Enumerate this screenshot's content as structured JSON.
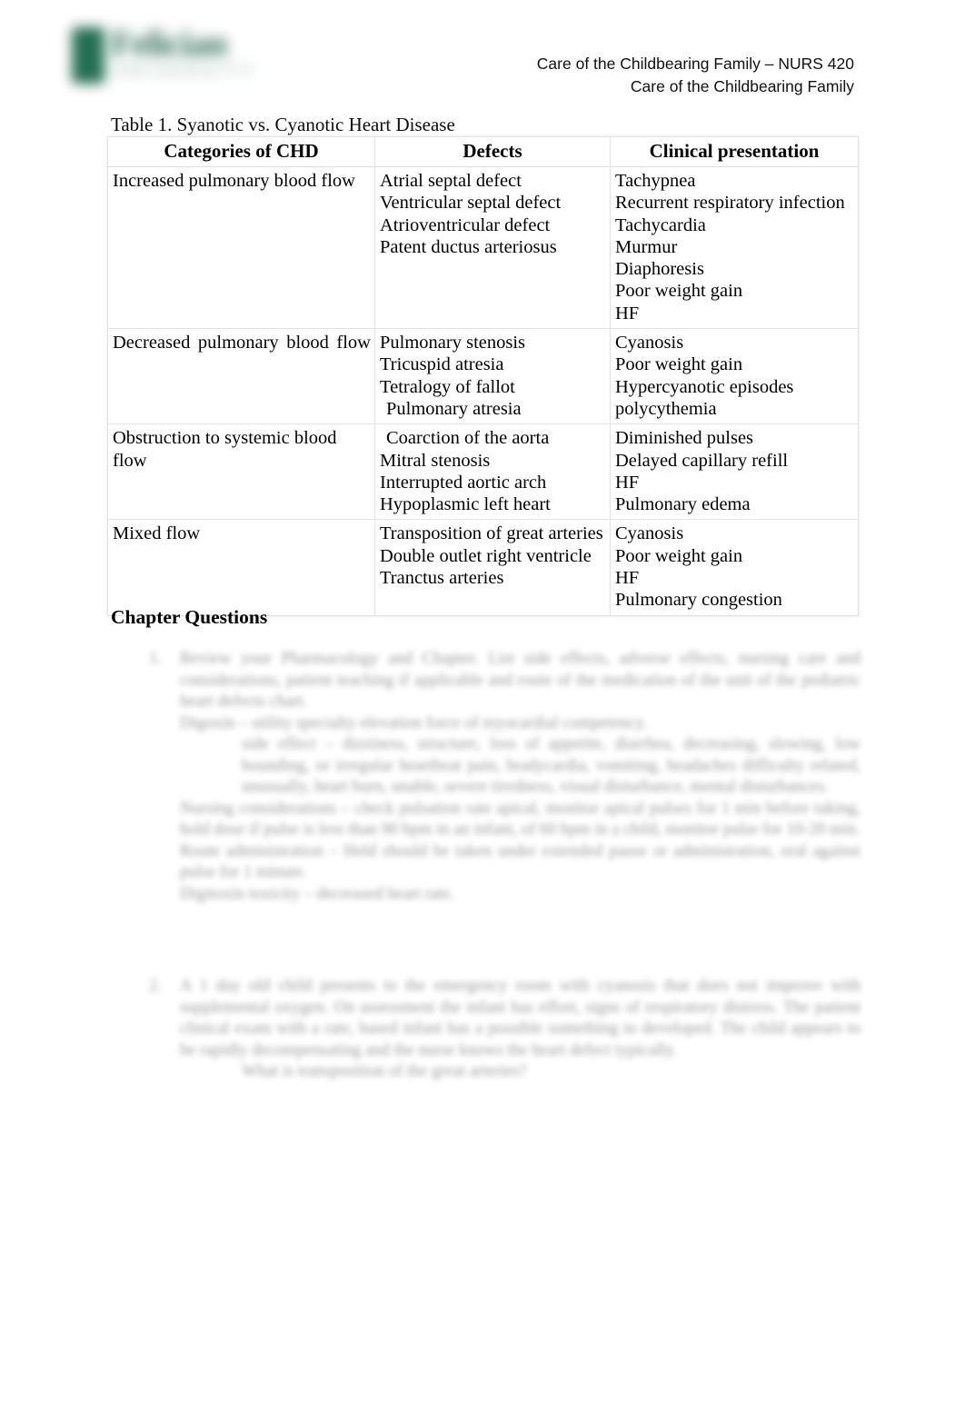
{
  "header": {
    "logo_word": "Felician",
    "logo_sub": "UNIVERSITY",
    "line1": "Care of the Childbearing Family – NURS 420",
    "line2": "Care of the Childbearing Family"
  },
  "table": {
    "caption": "Table 1. Syanotic vs. Cyanotic Heart Disease",
    "columns": [
      "Categories of CHD",
      "Defects",
      "Clinical presentation"
    ],
    "rows": [
      {
        "category": "Increased pulmonary blood flow",
        "defects": [
          "Atrial septal defect",
          "Ventricular septal defect",
          "Atrioventricular defect",
          "Patent ductus arteriosus"
        ],
        "clinical": [
          "Tachypnea",
          "Recurrent respiratory infection",
          "Tachycardia",
          "Murmur",
          "Diaphoresis",
          "Poor weight gain",
          "HF"
        ]
      },
      {
        "category": "Decreased pulmonary blood flow",
        "defects": [
          "Pulmonary stenosis",
          "Tricuspid atresia",
          "Tetralogy of fallot",
          "Pulmonary atresia"
        ],
        "clinical": [
          "Cyanosis",
          "Poor weight gain",
          "Hypercyanotic episodes",
          "polycythemia"
        ]
      },
      {
        "category": "Obstruction to systemic blood flow",
        "defects": [
          "Coarction of the aorta",
          "Mitral stenosis",
          "Interrupted aortic arch",
          "Hypoplasmic left heart"
        ],
        "clinical": [
          "Diminished pulses",
          "Delayed capillary refill",
          "HF",
          "Pulmonary edema"
        ]
      },
      {
        "category": "Mixed flow",
        "defects": [
          "Transposition of great arteries",
          "Double outlet right ventricle",
          "Tranctus arteries"
        ],
        "clinical": [
          "Cyanosis",
          "Poor weight gain",
          "HF",
          "Pulmonary congestion"
        ]
      }
    ]
  },
  "chapter_questions": {
    "heading": "Chapter Questions",
    "items": [
      {
        "number": "1.",
        "paragraphs": [
          "Review your Pharmacology and Chapter. List side effects, adverse effects, nursing care and considerations, patient teaching if applicable and route of the medication of the unit of the pediatric heart defects chart.",
          "Digoxin – utility specialty elevation force of myocardial competency.",
          "side effect – dizziness, structure, loss of appetite, diarrhea, decreasing, slowing, low bounding, or irregular heartbeat pain, bradycardia, vomiting, headaches difficulty related, unusually, heart burn, unable, severe tiredness, visual disturbance, mental disturbances.",
          "Nursing considerations – check pulsation rate apical, monitor apical pulses for 1 min before taking, hold dose if pulse is less than 90 bpm in an infant, of 60 bpm in a child, monitor pulse for 10-20 min.",
          "Route administration – Held should be taken under extended pause or administration, oral against pulse for 1 minute.",
          "Digitoxin toxicity – decreased heart rate."
        ]
      },
      {
        "number": "2.",
        "paragraphs": [
          "A 1 day old child presents to the emergency room with cyanosis that does not improve with supplemental oxygen. On assessment the infant has effort, signs of respiratory distress. The patient clinical exam with a rate, based infant has a possible something to developed. The child appears to be rapidly decompensating and the nurse knows the heart defect typically.",
          "What is transposition of the great arteries?"
        ]
      }
    ]
  }
}
